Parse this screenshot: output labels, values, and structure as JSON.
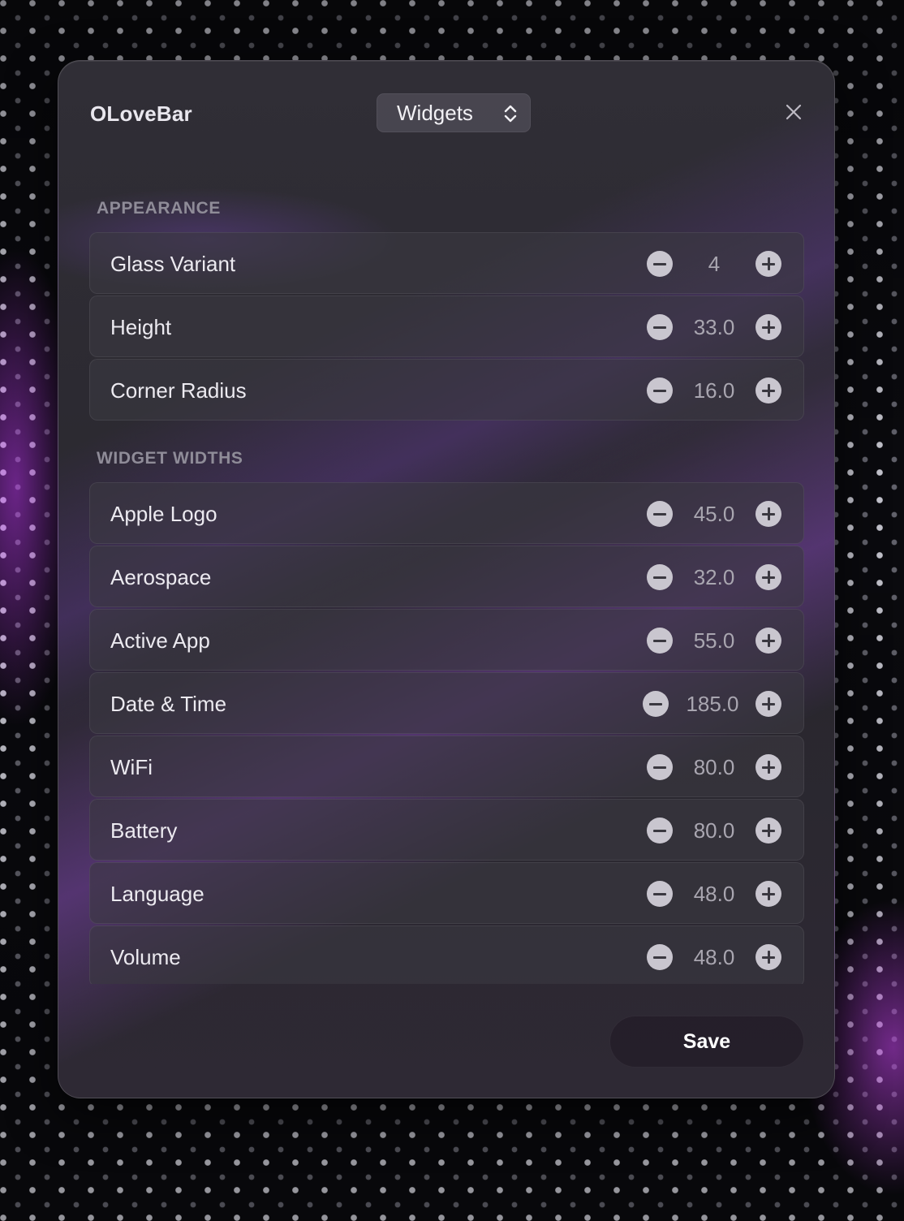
{
  "window": {
    "title": "OLoveBar",
    "view_selector": {
      "selected": "Widgets"
    }
  },
  "sections": [
    {
      "heading": "APPEARANCE",
      "rows": [
        {
          "label": "Glass Variant",
          "value": "4"
        },
        {
          "label": "Height",
          "value": "33.0"
        },
        {
          "label": "Corner Radius",
          "value": "16.0"
        }
      ]
    },
    {
      "heading": "WIDGET WIDTHS",
      "rows": [
        {
          "label": "Apple Logo",
          "value": "45.0"
        },
        {
          "label": "Aerospace",
          "value": "32.0"
        },
        {
          "label": "Active App",
          "value": "55.0"
        },
        {
          "label": "Date & Time",
          "value": "185.0"
        },
        {
          "label": "WiFi",
          "value": "80.0"
        },
        {
          "label": "Battery",
          "value": "80.0"
        },
        {
          "label": "Language",
          "value": "48.0"
        },
        {
          "label": "Volume",
          "value": "48.0"
        }
      ]
    }
  ],
  "footer": {
    "save_label": "Save"
  },
  "icons": {
    "close": "close-icon",
    "selector": "chevron-up-down-icon",
    "decrement": "minus-circle-icon",
    "increment": "plus-circle-icon"
  },
  "colors": {
    "panel": "#2a2830",
    "accent_glow": "#8c46c8",
    "stepper_button": "#c9c6cf"
  }
}
